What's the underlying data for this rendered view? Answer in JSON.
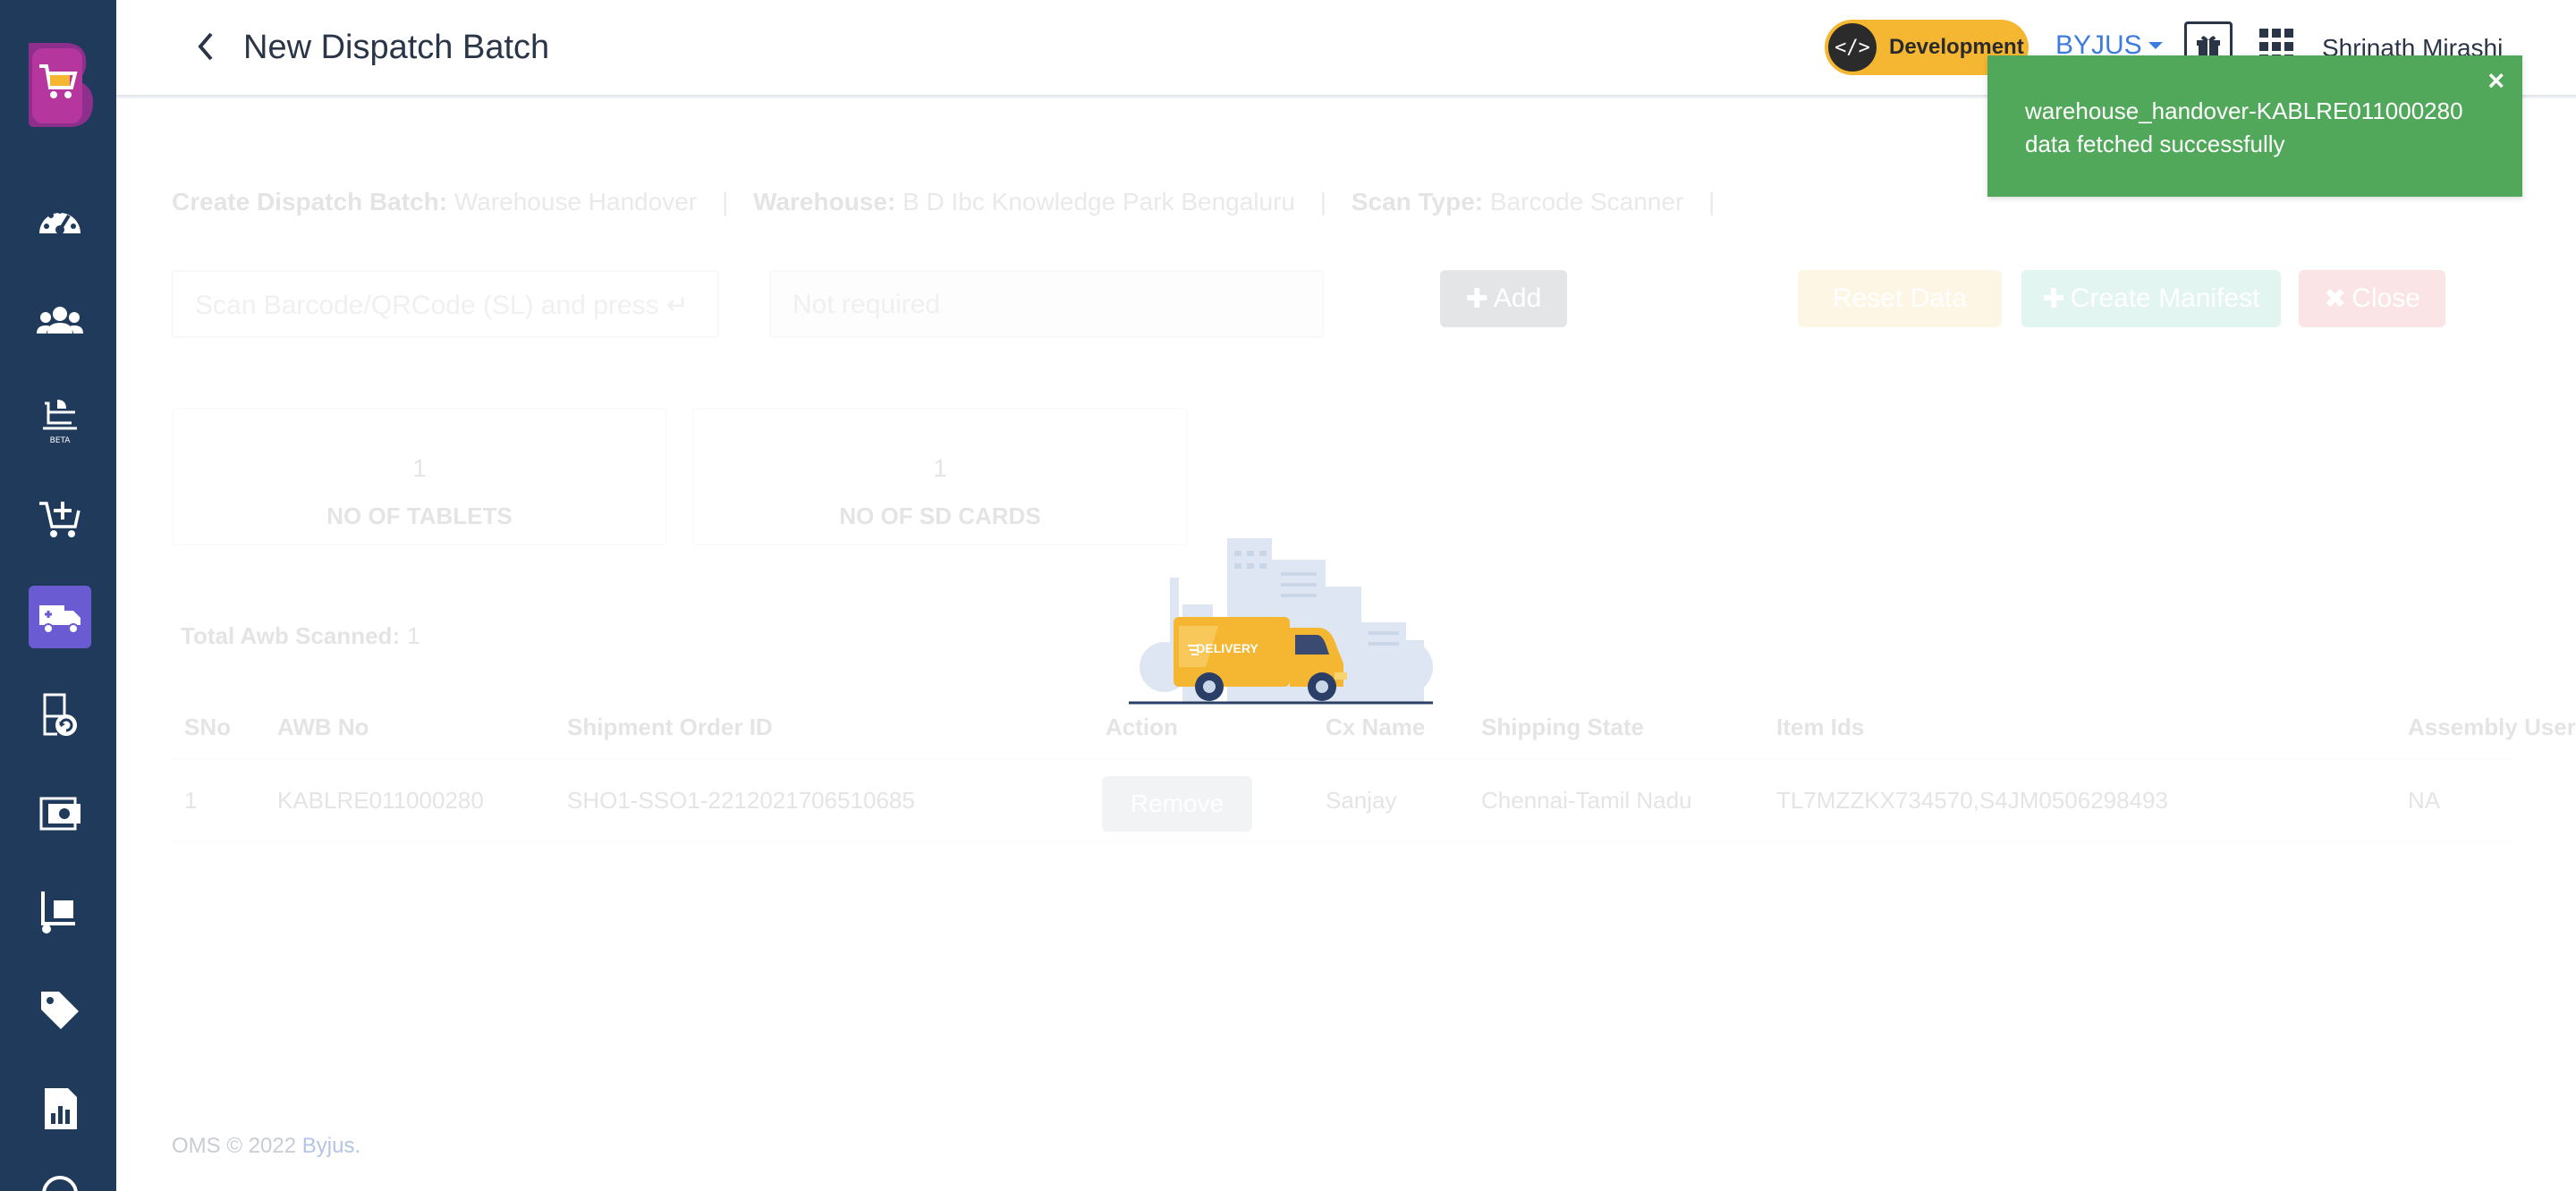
{
  "header": {
    "title": "New Dispatch Batch",
    "env_badge": "Development",
    "org": "BYJUS",
    "user": "Shrinath Mirashi"
  },
  "sidebar": {
    "icons": [
      "dashboard-icon",
      "users-icon",
      "beta-chef-icon",
      "cart-add-icon",
      "dispatch-truck-icon",
      "return-box-icon",
      "payment-icon",
      "dolly-icon",
      "tag-icon",
      "report-icon"
    ],
    "active": "dispatch-truck-icon"
  },
  "breadcrumb": {
    "create_label": "Create Dispatch Batch:",
    "create_value": "Warehouse Handover",
    "warehouse_label": "Warehouse:",
    "warehouse_value": "B D Ibc Knowledge Park Bengaluru",
    "scan_label": "Scan Type:",
    "scan_value": "Barcode Scanner",
    "sep": "|"
  },
  "inputs": {
    "scan_placeholder": "Scan Barcode/QRCode (SL) and press ↵",
    "secondary_placeholder": "Not required"
  },
  "buttons": {
    "add": "Add",
    "reset": "Reset Data",
    "create": "Create Manifest",
    "close": "Close",
    "remove": "Remove"
  },
  "stats": [
    {
      "value": "1",
      "label": "NO OF TABLETS"
    },
    {
      "value": "1",
      "label": "NO OF SD CARDS"
    }
  ],
  "total_awb": {
    "label": "Total Awb Scanned:",
    "value": "1"
  },
  "table": {
    "headers": [
      "SNo",
      "AWB No",
      "Shipment Order ID",
      "Action",
      "Cx Name",
      "Shipping State",
      "Item Ids",
      "Assembly User"
    ],
    "rows": [
      {
        "sno": "1",
        "awb": "KABLRE011000280",
        "order_id": "SHO1-SSO1-2212021706510685",
        "cx_name": "Sanjay",
        "state": "Chennai-Tamil Nadu",
        "item_ids": "TL7MZZKX734570,S4JM0506298493",
        "assembly_user": "NA"
      }
    ]
  },
  "loader": {
    "truck_text": "DELIVERY"
  },
  "toast": {
    "message": "warehouse_handover-KABLRE011000280 data fetched successfully",
    "close": "×"
  },
  "footer": {
    "copyright": "OMS © 2022",
    "brand": "Byjus."
  },
  "colors": {
    "sidebar": "#1f3a5a",
    "active_nav": "#6b5bd2",
    "toast": "#51a85a",
    "badge": "#f5b731",
    "link": "#3d7be0"
  }
}
